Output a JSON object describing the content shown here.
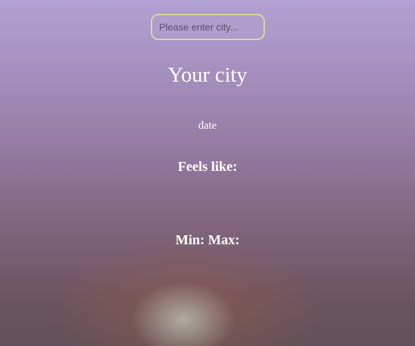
{
  "search": {
    "placeholder": "Please enter city...",
    "value": ""
  },
  "weather": {
    "city": "Your city",
    "date": "date",
    "feels_like_label": "Feels like:",
    "min_max_label": "Min: Max:"
  },
  "colors": {
    "input_border": "#d2dfa0",
    "text": "#ffffff",
    "background_top": "#b3a0d2",
    "background_bottom": "#625058"
  }
}
